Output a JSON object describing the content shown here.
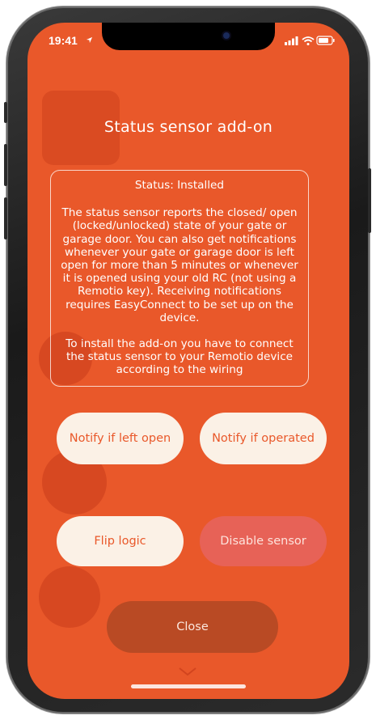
{
  "status_bar": {
    "time": "19:41",
    "location_icon": "location-arrow-icon",
    "signal_icon": "cellular-signal-icon",
    "wifi_icon": "wifi-icon",
    "battery_icon": "battery-icon"
  },
  "dialog": {
    "title": "Status sensor add-on",
    "status_line": "Status: Installed",
    "paragraphs": [
      "The status sensor reports the closed/ open (locked/unlocked) state of your gate or garage door. You can also get notifications whenever your gate or garage door is left open for more than 5 minutes or whenever it is opened using your old RC (not using a Remotio key). Receiving notifications requires EasyConnect to be set up on the device.",
      "To install the add-on you have to connect the status sensor to your Remotio device according to the wiring"
    ],
    "buttons": {
      "notify_left_open": "Notify if left open",
      "notify_operated": "Notify if operated",
      "flip_logic": "Flip logic",
      "disable_sensor": "Disable sensor",
      "close": "Close"
    }
  },
  "colors": {
    "background": "#e9582a",
    "button_light": "#fbf1e6",
    "button_disabled": "#e76257",
    "button_close": "#b94a24",
    "text": "#ffffff"
  }
}
